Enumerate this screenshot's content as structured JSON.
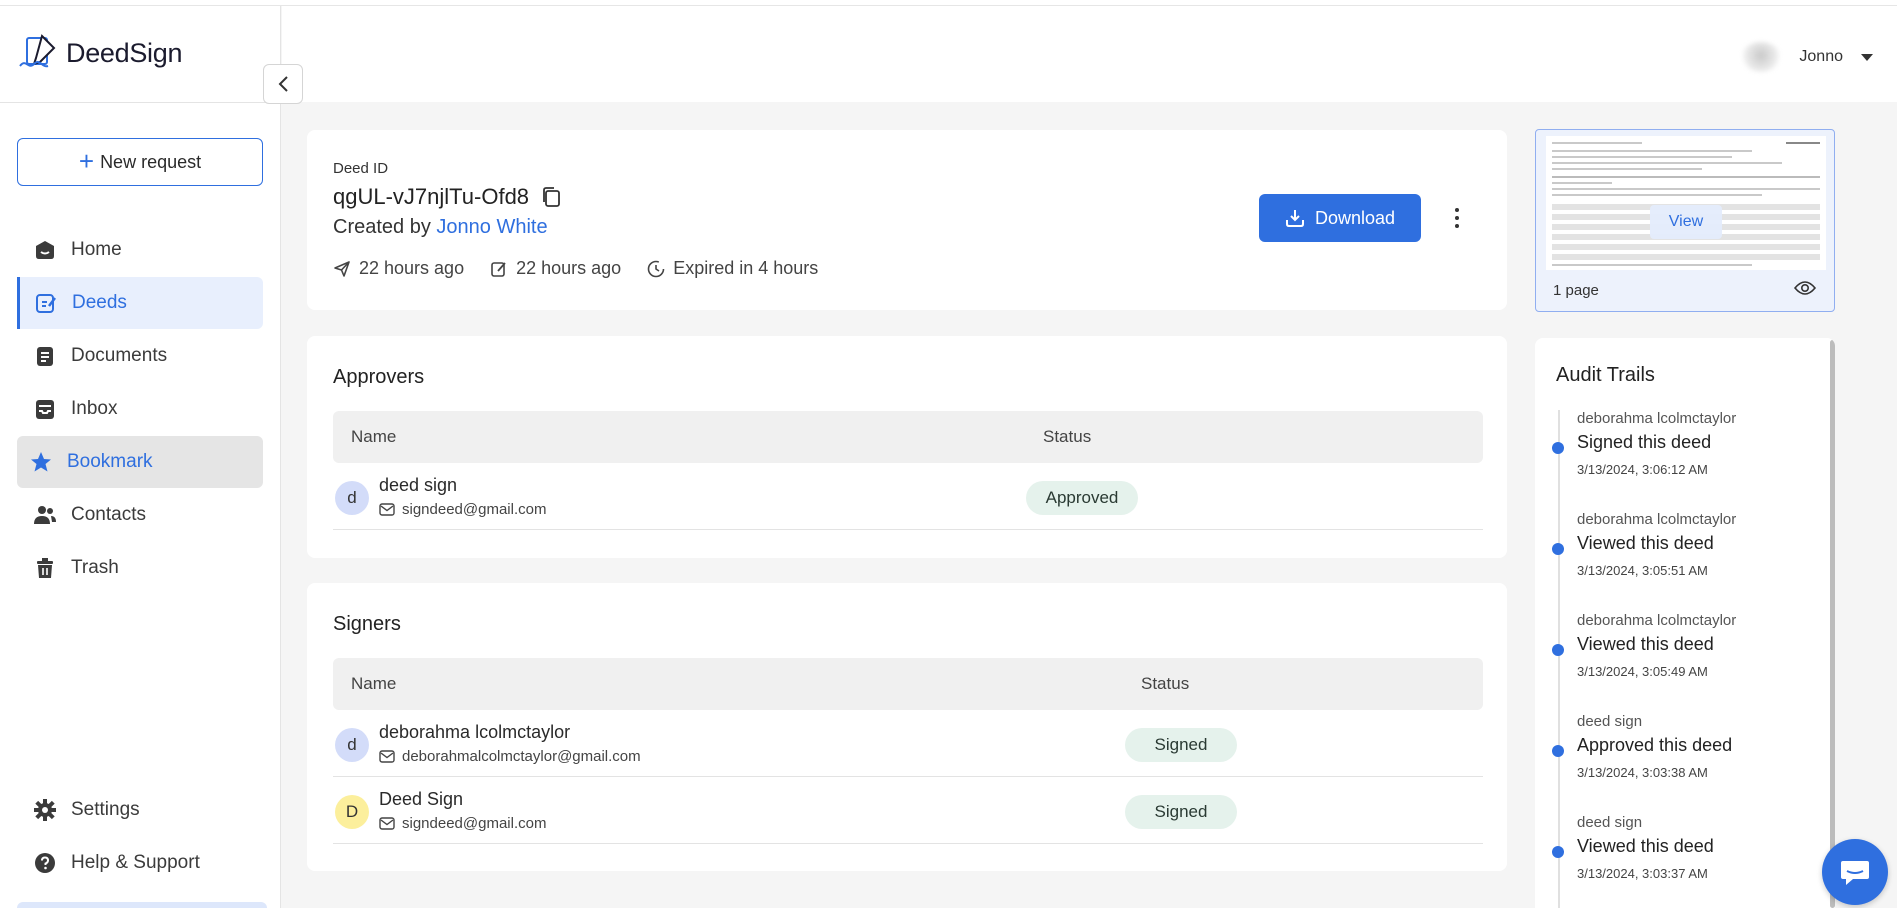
{
  "app": {
    "name": "DeedSign"
  },
  "sidebar": {
    "new_request_label": "New request",
    "items": [
      {
        "label": "Home",
        "icon": "home-icon"
      },
      {
        "label": "Deeds",
        "icon": "deeds-icon"
      },
      {
        "label": "Documents",
        "icon": "documents-icon"
      },
      {
        "label": "Inbox",
        "icon": "inbox-icon"
      },
      {
        "label": "Bookmark",
        "icon": "star-icon"
      },
      {
        "label": "Contacts",
        "icon": "contacts-icon"
      },
      {
        "label": "Trash",
        "icon": "trash-icon"
      }
    ],
    "bottom_items": [
      {
        "label": "Settings",
        "icon": "gear-icon"
      },
      {
        "label": "Help & Support",
        "icon": "help-icon"
      }
    ],
    "active_item": "Deeds",
    "hover_item": "Bookmark"
  },
  "header": {
    "user_name": "Jonno"
  },
  "deed": {
    "id_label": "Deed ID",
    "id": "qgUL-vJ7njlTu-Ofd8",
    "created_by_prefix": "Created by",
    "created_by": "Jonno White",
    "sent": "22 hours ago",
    "edited": "22 hours ago",
    "expiry": "Expired in 4 hours",
    "download_label": "Download"
  },
  "approvers": {
    "title": "Approvers",
    "col_name": "Name",
    "col_status": "Status",
    "rows": [
      {
        "initial": "d",
        "name": "deed sign",
        "email": "signdeed@gmail.com",
        "status": "Approved"
      }
    ]
  },
  "signers": {
    "title": "Signers",
    "col_name": "Name",
    "col_status": "Status",
    "rows": [
      {
        "initial": "d",
        "name": "deborahma lcolmctaylor",
        "email": "deborahmalcolmctaylor@gmail.com",
        "status": "Signed"
      },
      {
        "initial": "D",
        "name": "Deed Sign",
        "email": "signdeed@gmail.com",
        "status": "Signed"
      }
    ]
  },
  "preview": {
    "view_label": "View",
    "pages_label": "1 page"
  },
  "audit": {
    "title": "Audit Trails",
    "items": [
      {
        "who": "deborahma lcolmctaylor",
        "action": "Signed this deed",
        "time": "3/13/2024, 3:06:12 AM"
      },
      {
        "who": "deborahma lcolmctaylor",
        "action": "Viewed this deed",
        "time": "3/13/2024, 3:05:51 AM"
      },
      {
        "who": "deborahma lcolmctaylor",
        "action": "Viewed this deed",
        "time": "3/13/2024, 3:05:49 AM"
      },
      {
        "who": "deed sign",
        "action": "Approved this deed",
        "time": "3/13/2024, 3:03:38 AM"
      },
      {
        "who": "deed sign",
        "action": "Viewed this deed",
        "time": "3/13/2024, 3:03:37 AM"
      }
    ]
  },
  "colors": {
    "primary": "#2f6fdf",
    "badge_bg": "#e5f2ec",
    "active_bg": "#e8effd"
  }
}
